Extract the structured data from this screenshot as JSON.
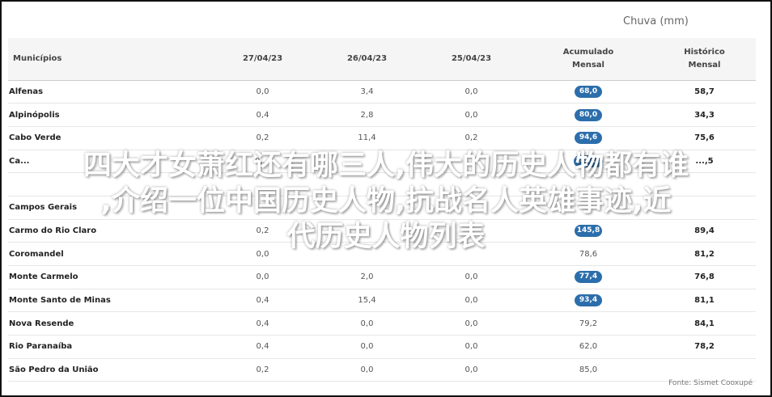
{
  "header": {
    "chuva_label": "Chuva (mm)"
  },
  "table": {
    "columns": [
      "Municípios",
      "27/04/23",
      "26/04/23",
      "25/04/23",
      "Acumulado Mensal",
      "Histórico Mensal"
    ],
    "rows": [
      {
        "city": "Alfenas",
        "d27": "0,0",
        "d26": "3,4",
        "d25": "0,0",
        "acc": "68,0",
        "acc_pill": true,
        "hist": "58,7"
      },
      {
        "city": "Alpinópolis",
        "d27": "0,4",
        "d26": "2,8",
        "d25": "0,0",
        "acc": "80,0",
        "acc_pill": true,
        "hist": "34,3"
      },
      {
        "city": "Cabo Verde",
        "d27": "0,2",
        "d26": "11,4",
        "d25": "0,2",
        "acc": "94,6",
        "acc_pill": true,
        "hist": "75,6"
      },
      {
        "city": "Ca...",
        "d27": "0,...",
        "d26": "",
        "d25": "",
        "acc": "140,...",
        "acc_pill": true,
        "hist": "...,5"
      },
      {
        "city": "",
        "d27": "",
        "d26": "",
        "d25": "",
        "acc": "",
        "acc_pill": true,
        "hist": ""
      },
      {
        "city": "Campos Gerais",
        "d27": "",
        "d26": "",
        "d25": "",
        "acc": "",
        "acc_pill": true,
        "hist": ""
      },
      {
        "city": "Carmo do Rio Claro",
        "d27": "0,2",
        "d26": "",
        "d25": "",
        "acc": "145,8",
        "acc_pill": true,
        "hist": "89,4"
      },
      {
        "city": "Coromandel",
        "d27": "0,0",
        "d26": "",
        "d25": "",
        "acc": "78,6",
        "acc_pill": false,
        "hist": "81,2"
      },
      {
        "city": "Monte Carmelo",
        "d27": "0,0",
        "d26": "2,0",
        "d25": "0,0",
        "acc": "77,4",
        "acc_pill": true,
        "hist": "76,8"
      },
      {
        "city": "Monte Santo de Minas",
        "d27": "0,4",
        "d26": "15,4",
        "d25": "0,0",
        "acc": "93,4",
        "acc_pill": true,
        "hist": "81,1"
      },
      {
        "city": "Nova Resende",
        "d27": "0,4",
        "d26": "0,0",
        "d25": "0,0",
        "acc": "79,2",
        "acc_pill": false,
        "hist": "84,1"
      },
      {
        "city": "Rio Paranaíba",
        "d27": "0,4",
        "d26": "0,0",
        "d25": "0,0",
        "acc": "62,0",
        "acc_pill": false,
        "hist": "78,2"
      },
      {
        "city": "São Pedro da União",
        "d27": "0,2",
        "d26": "0,0",
        "d25": "0,0",
        "acc": "85,0",
        "acc_pill": false,
        "hist": ""
      }
    ]
  },
  "source": "Fonte: Sismet Cooxupé",
  "overlay": {
    "line1": "四大才女萧红还有哪三人,伟大的历史人物都有谁",
    "line2": ",介绍一位中国历史人物,抗战名人英雄事迹,近",
    "line3": "代历史人物列表"
  },
  "colors": {
    "pill": "#2c6eab",
    "frame": "#111111",
    "header_bg": "#f5f5f5"
  }
}
